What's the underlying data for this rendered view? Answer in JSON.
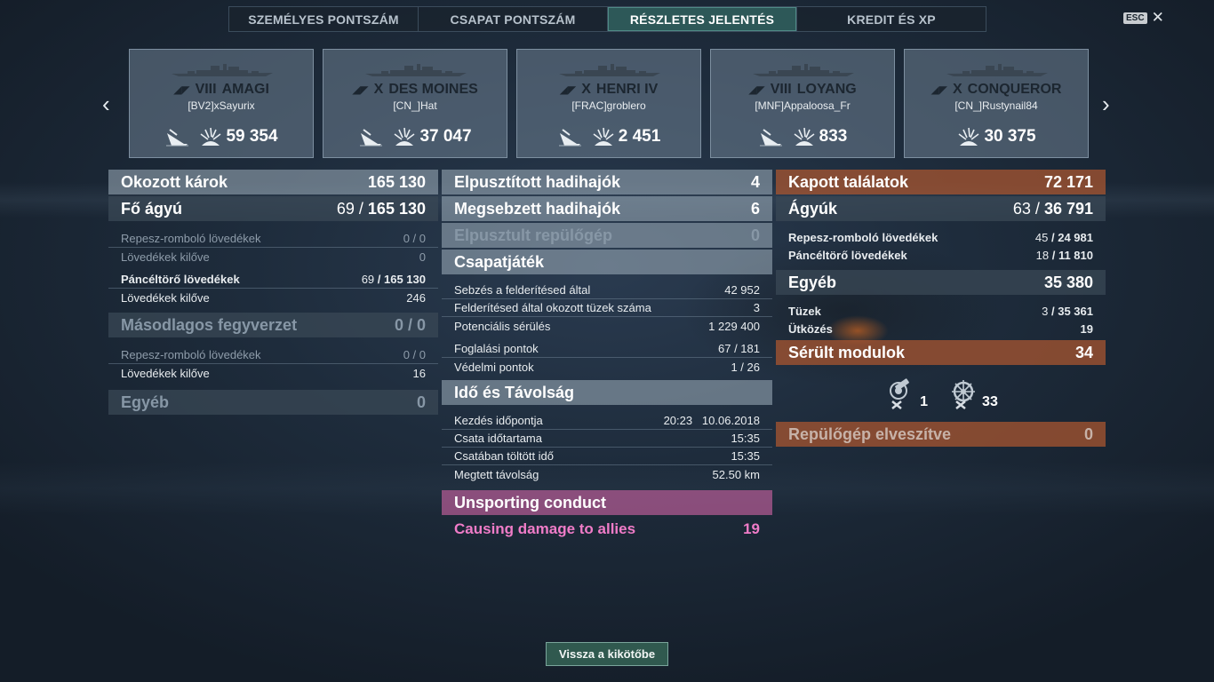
{
  "tabs": [
    {
      "label": "SZEMÉLYES PONTSZÁM"
    },
    {
      "label": "CSAPAT PONTSZÁM"
    },
    {
      "label": "RÉSZLETES JELENTÉS"
    },
    {
      "label": "KREDIT ÉS XP"
    }
  ],
  "active_tab": 2,
  "close": {
    "key_label": "ESC",
    "x": "✕"
  },
  "nav": {
    "prev": "‹",
    "next": "›"
  },
  "ships": [
    {
      "tier": "VIII",
      "name": "AMAGI",
      "player": "[BV2]xSayurix",
      "damage": "59 354",
      "has_sink": true
    },
    {
      "tier": "X",
      "name": "DES MOINES",
      "player": "[CN_]Hat",
      "damage": "37 047",
      "has_sink": true
    },
    {
      "tier": "X",
      "name": "HENRI IV",
      "player": "[FRAC]groblero",
      "damage": "2 451",
      "has_sink": true
    },
    {
      "tier": "VIII",
      "name": "LOYANG",
      "player": "[MNF]Appaloosa_Fr",
      "damage": "833",
      "has_sink": true
    },
    {
      "tier": "X",
      "name": "CONQUEROR",
      "player": "[CN_]Rustynail84",
      "damage": "30 375",
      "has_sink": false
    }
  ],
  "left": {
    "damage_caused": {
      "label": "Okozott károk",
      "value": "165 130"
    },
    "main_battery": {
      "label": "Fő ágyú",
      "hits": "69",
      "value": "165 130"
    },
    "he_label": "Repesz-romboló lövedékek",
    "he_value": "0 / 0",
    "he_fired_label": "Lövedékek kilőve",
    "he_fired_value": "0",
    "ap_label": "Páncéltörő lövedékek",
    "ap_hits": "69",
    "ap_value": "165 130",
    "ap_fired_label": "Lövedékek kilőve",
    "ap_fired_value": "246",
    "secondary": {
      "label": "Másodlagos fegyverzet",
      "value": "0 / 0"
    },
    "sec_he_label": "Repesz-romboló lövedékek",
    "sec_he_value": "0 / 0",
    "sec_fired_label": "Lövedékek kilőve",
    "sec_fired_value": "16",
    "other": {
      "label": "Egyéb",
      "value": "0"
    }
  },
  "middle": {
    "destroyed": {
      "label": "Elpusztított hadihajók",
      "value": "4"
    },
    "damaged": {
      "label": "Megsebzett hadihajók",
      "value": "6"
    },
    "planes": {
      "label": "Elpusztult repülőgép",
      "value": "0"
    },
    "team": {
      "label": "Csapatjáték"
    },
    "team_rows": [
      {
        "label": "Sebzés a felderítésed által",
        "value": "42 952"
      },
      {
        "label": "Felderítésed által okozott tüzek száma",
        "value": "3"
      },
      {
        "label": "Potenciális sérülés",
        "value": "1 229 400"
      },
      {
        "label": "Foglalási pontok",
        "value": "67 / 181"
      },
      {
        "label": "Védelmi pontok",
        "value": "1 / 26"
      }
    ],
    "time": {
      "label": "Idő és Távolság"
    },
    "time_rows": [
      {
        "label": "Kezdés időpontja",
        "value": "20:23   10.06.2018"
      },
      {
        "label": "Csata időtartama",
        "value": "15:35"
      },
      {
        "label": "Csatában töltött idő",
        "value": "15:35"
      },
      {
        "label": "Megtett távolság",
        "value": "52.50 km"
      }
    ],
    "unsporting": {
      "label": "Unsporting conduct"
    },
    "allies_damage": {
      "label": "Causing damage to allies",
      "value": "19"
    }
  },
  "right": {
    "hits_received": {
      "label": "Kapott találatok",
      "value": "72 171"
    },
    "guns": {
      "label": "Ágyúk",
      "hits": "63",
      "value": "36 791"
    },
    "he_label": "Repesz-romboló lövedékek",
    "he_hits": "45",
    "he_value": "24 981",
    "ap_label": "Páncéltörő lövedékek",
    "ap_hits": "18",
    "ap_value": "11 810",
    "other": {
      "label": "Egyéb",
      "value": "35 380"
    },
    "fires_label": "Tüzek",
    "fires_hits": "3",
    "fires_value": "35 361",
    "ram_label": "Ütközés",
    "ram_value": "19",
    "modules": {
      "label": "Sérült modulok",
      "value": "34"
    },
    "module_icons": [
      {
        "icon": "gun-module-icon",
        "count": "1"
      },
      {
        "icon": "steering-module-icon",
        "count": "33"
      }
    ],
    "planes_lost": {
      "label": "Repülőgép elveszítve",
      "value": "0"
    }
  },
  "footer": {
    "back_label": "Vissza a kikötőbe"
  }
}
